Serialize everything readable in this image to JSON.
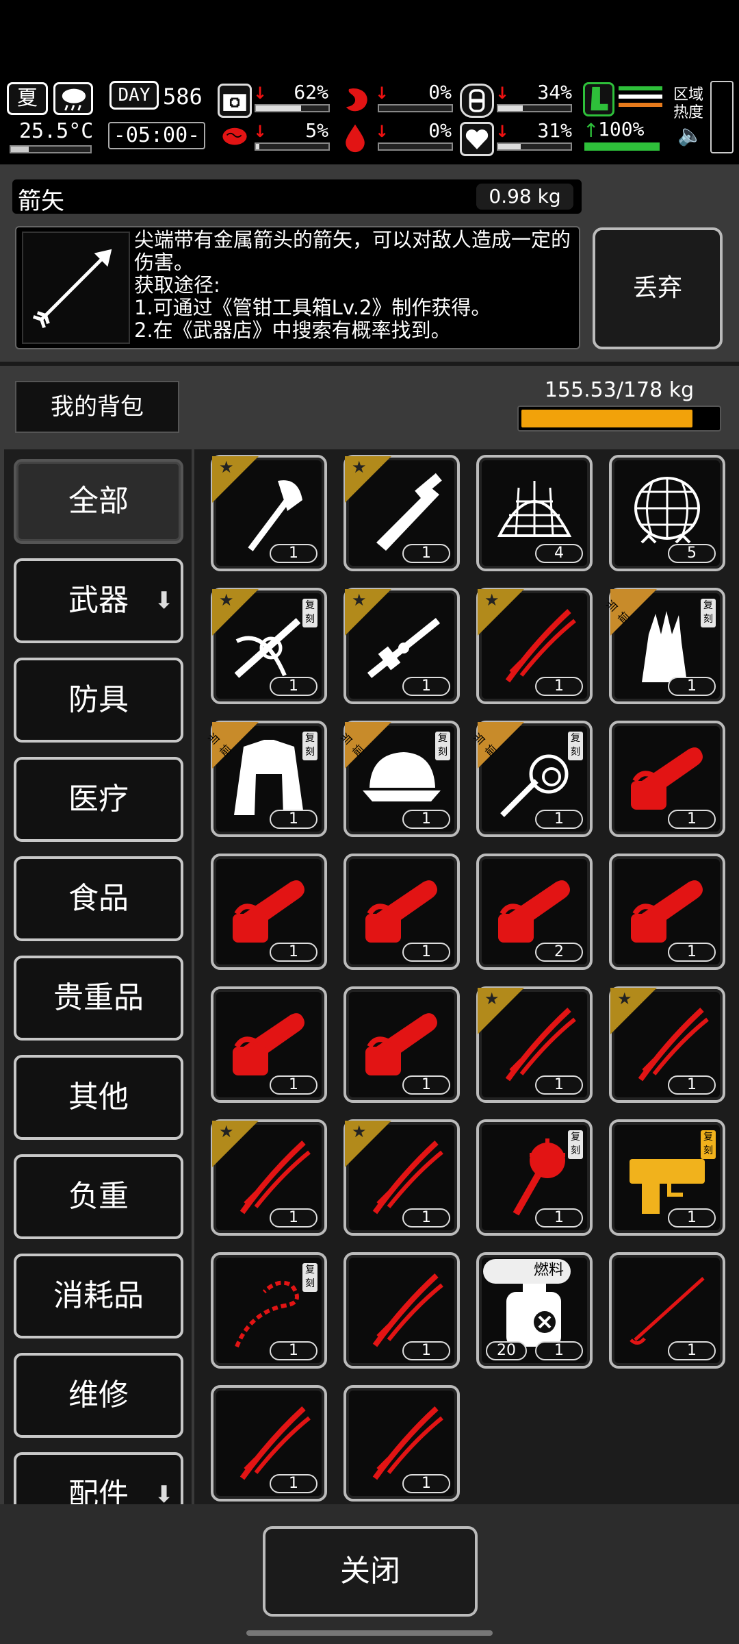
{
  "hud": {
    "season": "夏",
    "temperature": "25.5°C",
    "day_label": "DAY",
    "day_number": "586",
    "time": "-05:00-",
    "stats": [
      {
        "icon": "medkit-icon",
        "value": "62%",
        "level": 0.62
      },
      {
        "icon": "stomach-icon",
        "value": "0%",
        "level": 0.0
      },
      {
        "icon": "water-bottle-icon",
        "value": "34%",
        "level": 0.34
      },
      {
        "icon": "brain-icon",
        "value": "5%",
        "level": 0.05
      },
      {
        "icon": "blood-drop-icon",
        "value": "0%",
        "level": 0.0
      },
      {
        "icon": "heart-icon",
        "value": "31%",
        "level": 0.31
      }
    ],
    "stamina": "100%",
    "zone_heat_label": "区域热度"
  },
  "selected_item": {
    "name": "箭矢",
    "weight": "0.98 kg",
    "description_lines": [
      "尖端带有金属箭头的箭矢，可以对敌人造成一定的伤害。",
      "获取途径:",
      "1.可通过《管钳工具箱Lv.2》制作获得。",
      "2.在《武器店》中搜索有概率找到。"
    ],
    "discard_label": "丢弃"
  },
  "backpack": {
    "title": "我的背包",
    "capacity_text": "155.53/178 kg",
    "capacity_fraction": 0.873
  },
  "tabs": [
    {
      "label": "全部",
      "active": true
    },
    {
      "label": "武器",
      "arrow": "⬇"
    },
    {
      "label": "防具"
    },
    {
      "label": "医疗"
    },
    {
      "label": "食品"
    },
    {
      "label": "贵重品"
    },
    {
      "label": "其他"
    },
    {
      "label": "负重"
    },
    {
      "label": "消耗品"
    },
    {
      "label": "维修"
    },
    {
      "label": "配件",
      "arrow": "⬇"
    }
  ],
  "badges": {
    "replica": "复刻",
    "current": "当前",
    "fuel": "燃料"
  },
  "items": [
    {
      "icon": "axe-icon",
      "count": "1",
      "corner": "star"
    },
    {
      "icon": "machete-icon",
      "count": "1",
      "corner": "star"
    },
    {
      "icon": "net-icon",
      "count": "4"
    },
    {
      "icon": "net-dome-icon",
      "count": "5"
    },
    {
      "icon": "crossbow-icon",
      "count": "1",
      "corner": "star",
      "replica": true
    },
    {
      "icon": "rifle-icon",
      "count": "1",
      "corner": "star"
    },
    {
      "icon": "katana-icon",
      "count": "1",
      "corner": "star",
      "red": true
    },
    {
      "icon": "gloves-icon",
      "count": "1",
      "corner": "current",
      "replica": true
    },
    {
      "icon": "coat-icon",
      "count": "1",
      "corner": "current",
      "replica": true
    },
    {
      "icon": "cap-icon",
      "count": "1",
      "corner": "current",
      "replica": true
    },
    {
      "icon": "whip-icon",
      "count": "1",
      "corner": "current",
      "replica": true
    },
    {
      "icon": "chainsaw-icon",
      "count": "1",
      "red": true
    },
    {
      "icon": "chainsaw-icon",
      "count": "1",
      "red": true
    },
    {
      "icon": "chainsaw-icon",
      "count": "1",
      "red": true
    },
    {
      "icon": "chainsaw-icon",
      "count": "2",
      "red": true
    },
    {
      "icon": "chainsaw-icon",
      "count": "1",
      "red": true
    },
    {
      "icon": "chainsaw-icon",
      "count": "1",
      "red": true
    },
    {
      "icon": "chainsaw-icon",
      "count": "1",
      "red": true
    },
    {
      "icon": "katana-icon",
      "count": "1",
      "corner": "star",
      "red": true
    },
    {
      "icon": "katana-icon",
      "count": "1",
      "corner": "star",
      "red": true
    },
    {
      "icon": "katana-icon",
      "count": "1",
      "corner": "star",
      "red": true
    },
    {
      "icon": "katana-icon",
      "count": "1",
      "corner": "star",
      "red": true
    },
    {
      "icon": "mace-icon",
      "count": "1",
      "red": true,
      "replica": true
    },
    {
      "icon": "gold-gun-icon",
      "count": "1",
      "gold": true,
      "replica": true
    },
    {
      "icon": "chain-whip-icon",
      "count": "1",
      "red": true,
      "replica": true
    },
    {
      "icon": "katana-icon",
      "count": "1",
      "red": true
    },
    {
      "icon": "fuel-can-icon",
      "count": "1",
      "count_left": "20",
      "fuel": true
    },
    {
      "icon": "spear-icon",
      "count": "1",
      "red": true
    },
    {
      "icon": "katana-icon",
      "count": "1",
      "red": true
    },
    {
      "icon": "katana-icon",
      "count": "1",
      "red": true
    }
  ],
  "close_label": "关闭",
  "colors": {
    "accent": "#f2a20a",
    "item_red": "#e21414",
    "gold": "#f1b21c",
    "green": "#2ec03a"
  }
}
